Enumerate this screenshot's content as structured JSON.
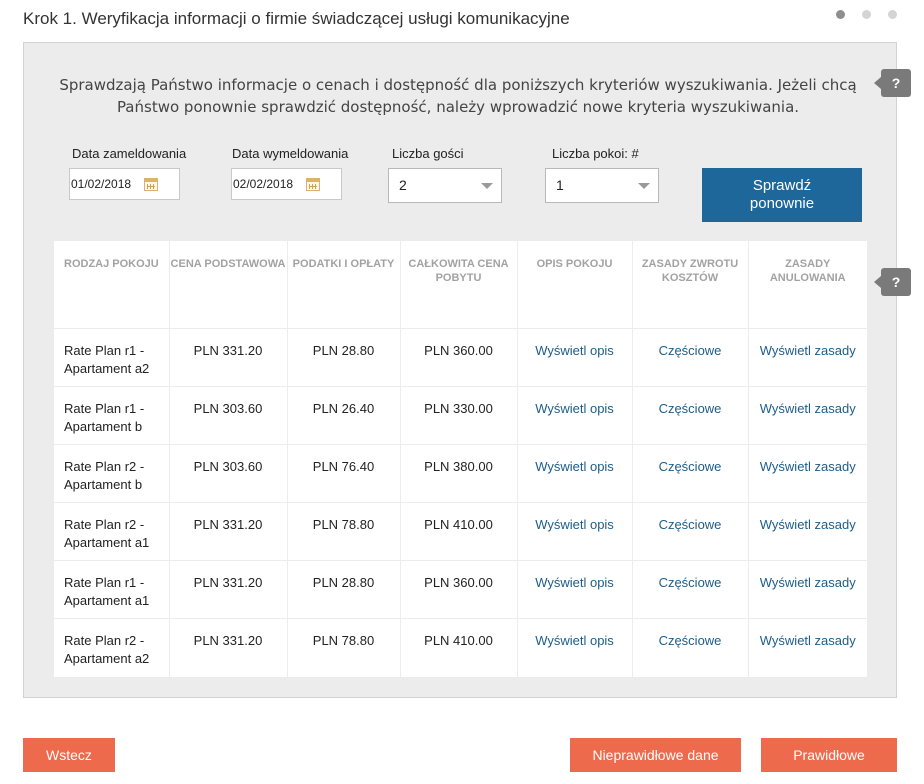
{
  "header": {
    "step_title": "Krok 1. Weryfikacja informacji o firmie świadczącej usługi komunikacyjne",
    "progress": {
      "total_steps": 3,
      "current_step": 1
    }
  },
  "intro": {
    "text": "Sprawdzają Państwo informacje o cenach i dostępność dla poniższych kryteriów wyszukiwania. Jeżeli chcą Państwo ponownie sprawdzić dostępność, należy wprowadzić nowe kryteria wyszukiwania."
  },
  "help_icon": "?",
  "search": {
    "checkin_label": "Data zameldowania",
    "checkin_value": "01/02/2018",
    "checkout_label": "Data wymeldowania",
    "checkout_value": "02/02/2018",
    "guests_label": "Liczba gości",
    "guests_value": "2",
    "rooms_label": "Liczba pokoi: #",
    "rooms_value": "1",
    "check_again_label": "Sprawdź ponownie"
  },
  "table": {
    "headers": [
      "RODZAJ POKOJU",
      "CENA PODSTAWOWA",
      "PODATKI I OPŁATY",
      "CAŁKOWITA CENA POBYTU",
      "OPIS POKOJU",
      "ZASADY ZWROTU KOSZTÓW",
      "ZASADY ANULOWANIA"
    ],
    "rows": [
      {
        "room": "Rate Plan r1 - Apartament a2",
        "base": "PLN 331.20",
        "taxes": "PLN 28.80",
        "total": "PLN 360.00",
        "desc": "Wyświetl opis",
        "refund": "Częściowe",
        "cancel": "Wyświetl zasady"
      },
      {
        "room": "Rate Plan r1 - Apartament b",
        "base": "PLN 303.60",
        "taxes": "PLN 26.40",
        "total": "PLN 330.00",
        "desc": "Wyświetl opis",
        "refund": "Częściowe",
        "cancel": "Wyświetl zasady"
      },
      {
        "room": "Rate Plan r2 - Apartament b",
        "base": "PLN 303.60",
        "taxes": "PLN 76.40",
        "total": "PLN 380.00",
        "desc": "Wyświetl opis",
        "refund": "Częściowe",
        "cancel": "Wyświetl zasady"
      },
      {
        "room": "Rate Plan r2 - Apartament a1",
        "base": "PLN 331.20",
        "taxes": "PLN 78.80",
        "total": "PLN 410.00",
        "desc": "Wyświetl opis",
        "refund": "Częściowe",
        "cancel": "Wyświetl zasady"
      },
      {
        "room": "Rate Plan r1 - Apartament a1",
        "base": "PLN 331.20",
        "taxes": "PLN 28.80",
        "total": "PLN 360.00",
        "desc": "Wyświetl opis",
        "refund": "Częściowe",
        "cancel": "Wyświetl zasady"
      },
      {
        "room": "Rate Plan r2 - Apartament a2",
        "base": "PLN 331.20",
        "taxes": "PLN 78.80",
        "total": "PLN 410.00",
        "desc": "Wyświetl opis",
        "refund": "Częściowe",
        "cancel": "Wyświetl zasady"
      }
    ]
  },
  "footer": {
    "back_label": "Wstecz",
    "incorrect_label": "Nieprawidłowe dane",
    "correct_label": "Prawidłowe"
  },
  "colors": {
    "primary_button": "#1d679a",
    "action_button": "#ee6a4c",
    "link": "#1d5d8a",
    "panel_bg": "#ececec"
  }
}
